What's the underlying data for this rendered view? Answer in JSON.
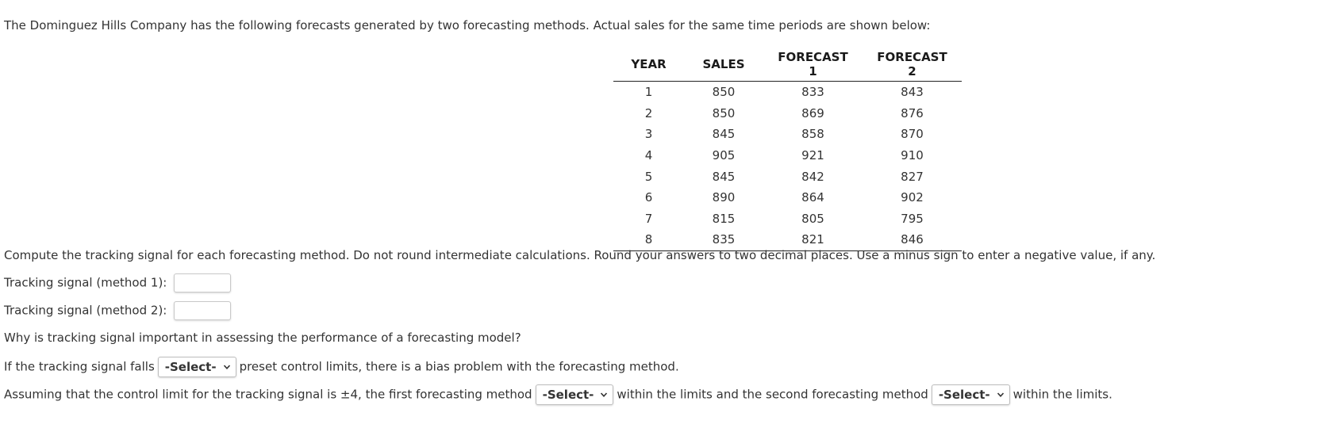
{
  "intro": "The Dominguez Hills Company has the following forecasts generated by two forecasting methods. Actual sales for the same time periods are shown below:",
  "table": {
    "headers": [
      "YEAR",
      "SALES",
      "FORECAST 1",
      "FORECAST 2"
    ],
    "rows": [
      [
        "1",
        "850",
        "833",
        "843"
      ],
      [
        "2",
        "850",
        "869",
        "876"
      ],
      [
        "3",
        "845",
        "858",
        "870"
      ],
      [
        "4",
        "905",
        "921",
        "910"
      ],
      [
        "5",
        "845",
        "842",
        "827"
      ],
      [
        "6",
        "890",
        "864",
        "902"
      ],
      [
        "7",
        "815",
        "805",
        "795"
      ],
      [
        "8",
        "835",
        "821",
        "846"
      ]
    ]
  },
  "instructions": "Compute the tracking signal for each forecasting method. Do not round intermediate calculations. Round your answers to two decimal places. Use a minus sign to enter a negative value, if any.",
  "method1": {
    "label": "Tracking signal (method 1):",
    "value": ""
  },
  "method2": {
    "label": "Tracking signal (method 2):",
    "value": ""
  },
  "why_question": "Why is tracking signal important in assessing the performance of a forecasting model?",
  "if_sentence": {
    "before": "If the tracking signal falls",
    "select": "-Select-",
    "after": "preset control limits, there is a bias problem with the forecasting method."
  },
  "assume_sentence": {
    "before": "Assuming that the control limit for the tracking signal is ±4, the first forecasting method",
    "select1": "-Select-",
    "middle": "within the limits and the second forecasting method",
    "select2": "-Select-",
    "after": "within the limits."
  }
}
